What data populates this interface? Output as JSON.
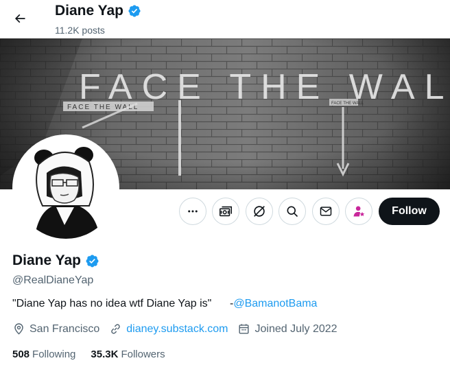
{
  "header": {
    "name": "Diane Yap",
    "posts": "11.2K posts"
  },
  "banner": {
    "headline": "FACE THE WALL",
    "sign_left": "FACE THE WALL",
    "sign_right": "FACE THE WALL"
  },
  "actions": {
    "follow_label": "Follow"
  },
  "profile": {
    "name": "Diane Yap",
    "handle": "@RealDianeYap",
    "bio_text": "\"Diane Yap has no idea wtf Diane Yap is\"      -",
    "bio_mention": "@BamanotBama",
    "location": "San Francisco",
    "website": "dianey.substack.com",
    "joined": "Joined July 2022"
  },
  "stats": {
    "following_count": "508",
    "following_label": "Following",
    "followers_count": "35.3K",
    "followers_label": "Followers"
  },
  "colors": {
    "accent": "#1d9bf0",
    "verified": "#1d9bf0",
    "subscribe": "#c9269b",
    "follow_bg": "#0f1419"
  }
}
